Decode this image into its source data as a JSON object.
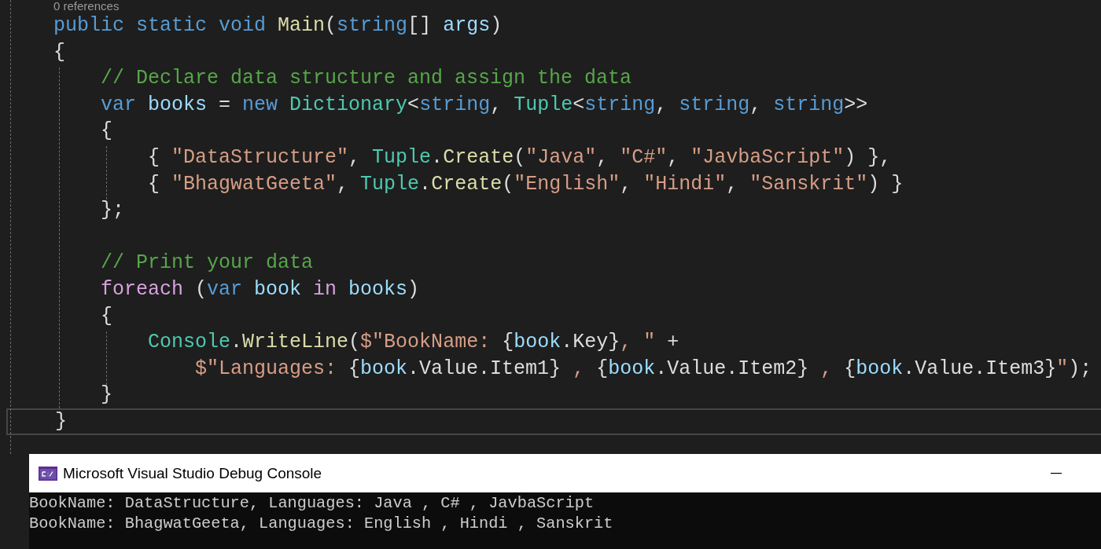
{
  "editor": {
    "codelens": "0 references",
    "lines": [
      {
        "kind": "code",
        "current": false,
        "tokens": [
          {
            "kind": "keyword",
            "text": "public "
          },
          {
            "kind": "keyword",
            "text": "static "
          },
          {
            "kind": "keyword",
            "text": "void "
          },
          {
            "kind": "method",
            "text": "Main"
          },
          {
            "kind": "plain",
            "text": "("
          },
          {
            "kind": "keyword",
            "text": "string"
          },
          {
            "kind": "plain",
            "text": "[] "
          },
          {
            "kind": "variable",
            "text": "args"
          },
          {
            "kind": "plain",
            "text": ")"
          }
        ]
      },
      {
        "kind": "code",
        "current": false,
        "tokens": [
          {
            "kind": "plain",
            "text": "{"
          }
        ]
      },
      {
        "kind": "code",
        "current": false,
        "tokens": [
          {
            "kind": "comment",
            "text": "    // Declare data structure and assign the data"
          }
        ]
      },
      {
        "kind": "code",
        "current": false,
        "tokens": [
          {
            "kind": "keyword",
            "text": "    var "
          },
          {
            "kind": "variable",
            "text": "books "
          },
          {
            "kind": "plain",
            "text": "= "
          },
          {
            "kind": "keyword",
            "text": "new "
          },
          {
            "kind": "type",
            "text": "Dictionary"
          },
          {
            "kind": "plain",
            "text": "<"
          },
          {
            "kind": "keyword",
            "text": "string"
          },
          {
            "kind": "plain",
            "text": ", "
          },
          {
            "kind": "type",
            "text": "Tuple"
          },
          {
            "kind": "plain",
            "text": "<"
          },
          {
            "kind": "keyword",
            "text": "string"
          },
          {
            "kind": "plain",
            "text": ", "
          },
          {
            "kind": "keyword",
            "text": "string"
          },
          {
            "kind": "plain",
            "text": ", "
          },
          {
            "kind": "keyword",
            "text": "string"
          },
          {
            "kind": "plain",
            "text": ">>"
          }
        ]
      },
      {
        "kind": "code",
        "current": false,
        "tokens": [
          {
            "kind": "plain",
            "text": "    {"
          }
        ]
      },
      {
        "kind": "code",
        "current": false,
        "tokens": [
          {
            "kind": "plain",
            "text": "        { "
          },
          {
            "kind": "string",
            "text": "\"DataStructure\""
          },
          {
            "kind": "plain",
            "text": ", "
          },
          {
            "kind": "type",
            "text": "Tuple"
          },
          {
            "kind": "plain",
            "text": "."
          },
          {
            "kind": "method",
            "text": "Create"
          },
          {
            "kind": "plain",
            "text": "("
          },
          {
            "kind": "string",
            "text": "\"Java\""
          },
          {
            "kind": "plain",
            "text": ", "
          },
          {
            "kind": "string",
            "text": "\"C#\""
          },
          {
            "kind": "plain",
            "text": ", "
          },
          {
            "kind": "string",
            "text": "\"JavbaScript\""
          },
          {
            "kind": "plain",
            "text": ") },"
          }
        ]
      },
      {
        "kind": "code",
        "current": false,
        "tokens": [
          {
            "kind": "plain",
            "text": "        { "
          },
          {
            "kind": "string",
            "text": "\"BhagwatGeeta\""
          },
          {
            "kind": "plain",
            "text": ", "
          },
          {
            "kind": "type",
            "text": "Tuple"
          },
          {
            "kind": "plain",
            "text": "."
          },
          {
            "kind": "method",
            "text": "Create"
          },
          {
            "kind": "plain",
            "text": "("
          },
          {
            "kind": "string",
            "text": "\"English\""
          },
          {
            "kind": "plain",
            "text": ", "
          },
          {
            "kind": "string",
            "text": "\"Hindi\""
          },
          {
            "kind": "plain",
            "text": ", "
          },
          {
            "kind": "string",
            "text": "\"Sanskrit\""
          },
          {
            "kind": "plain",
            "text": ") }"
          }
        ]
      },
      {
        "kind": "code",
        "current": false,
        "tokens": [
          {
            "kind": "plain",
            "text": "    };"
          }
        ]
      },
      {
        "kind": "blank"
      },
      {
        "kind": "code",
        "current": false,
        "tokens": [
          {
            "kind": "comment",
            "text": "    // Print your data"
          }
        ]
      },
      {
        "kind": "code",
        "current": false,
        "tokens": [
          {
            "kind": "control",
            "text": "    foreach "
          },
          {
            "kind": "plain",
            "text": "("
          },
          {
            "kind": "keyword",
            "text": "var "
          },
          {
            "kind": "variable",
            "text": "book "
          },
          {
            "kind": "control",
            "text": "in "
          },
          {
            "kind": "variable",
            "text": "books"
          },
          {
            "kind": "plain",
            "text": ")"
          }
        ]
      },
      {
        "kind": "code",
        "current": false,
        "tokens": [
          {
            "kind": "plain",
            "text": "    {"
          }
        ]
      },
      {
        "kind": "code",
        "current": false,
        "tokens": [
          {
            "kind": "type",
            "text": "        Console"
          },
          {
            "kind": "plain",
            "text": "."
          },
          {
            "kind": "method",
            "text": "WriteLine"
          },
          {
            "kind": "plain",
            "text": "("
          },
          {
            "kind": "string",
            "text": "$\"BookName: "
          },
          {
            "kind": "plain",
            "text": "{"
          },
          {
            "kind": "variable",
            "text": "book"
          },
          {
            "kind": "plain",
            "text": ".Key}"
          },
          {
            "kind": "string",
            "text": ", \""
          },
          {
            "kind": "plain",
            "text": " +"
          }
        ]
      },
      {
        "kind": "code",
        "current": false,
        "tokens": [
          {
            "kind": "string",
            "text": "            $\"Languages: "
          },
          {
            "kind": "plain",
            "text": "{"
          },
          {
            "kind": "variable",
            "text": "book"
          },
          {
            "kind": "plain",
            "text": ".Value.Item1}"
          },
          {
            "kind": "string",
            "text": " , "
          },
          {
            "kind": "plain",
            "text": "{"
          },
          {
            "kind": "variable",
            "text": "book"
          },
          {
            "kind": "plain",
            "text": ".Value.Item2}"
          },
          {
            "kind": "string",
            "text": " , "
          },
          {
            "kind": "plain",
            "text": "{"
          },
          {
            "kind": "variable",
            "text": "book"
          },
          {
            "kind": "plain",
            "text": ".Value.Item3}"
          },
          {
            "kind": "string",
            "text": "\""
          },
          {
            "kind": "plain",
            "text": ");"
          }
        ]
      },
      {
        "kind": "code",
        "current": false,
        "tokens": [
          {
            "kind": "plain",
            "text": "    }"
          }
        ]
      },
      {
        "kind": "code",
        "current": true,
        "tokens": [
          {
            "kind": "plain",
            "text": "}"
          }
        ]
      }
    ]
  },
  "console": {
    "title": "Microsoft Visual Studio Debug Console",
    "output": [
      "BookName: DataStructure, Languages: Java , C# , JavbaScript",
      "BookName: BhagwatGeeta, Languages: English , Hindi , Sanskrit"
    ]
  }
}
